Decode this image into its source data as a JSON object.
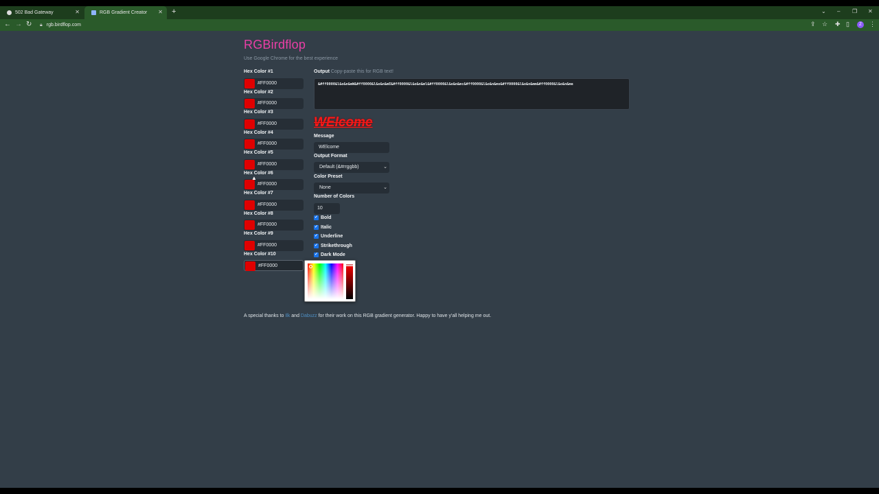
{
  "browser": {
    "tabs": [
      {
        "title": "502 Bad Gateway",
        "active": false
      },
      {
        "title": "RGB Gradient Creator",
        "active": true
      }
    ],
    "address": "rgb.birdflop.com"
  },
  "page": {
    "brand": "RGBirdflop",
    "subtitle": "Use Google Chrome for the best experience",
    "hex_colors": [
      {
        "label": "Hex Color #1",
        "value": "#FF0000"
      },
      {
        "label": "Hex Color #2",
        "value": "#FF0000"
      },
      {
        "label": "Hex Color #3",
        "value": "#FF0000"
      },
      {
        "label": "Hex Color #4",
        "value": "#FF0000"
      },
      {
        "label": "Hex Color #5",
        "value": "#FF0000"
      },
      {
        "label": "Hex Color #6",
        "value": "#FF0000"
      },
      {
        "label": "Hex Color #7",
        "value": "#FF0000"
      },
      {
        "label": "Hex Color #8",
        "value": "#FF0000"
      },
      {
        "label": "Hex Color #9",
        "value": "#FF0000"
      },
      {
        "label": "Hex Color #10",
        "value": "#FF0000"
      }
    ],
    "output": {
      "label": "Output",
      "hint": "Copy-paste this for RGB text!",
      "text": "&#ff0000&l&o&n&mW&#ff0000&l&o&n&mE&#ff0000&l&o&n&ml&#ff0000&l&o&n&mc&#ff0000&l&o&n&mo&#ff0000&l&o&n&mm&#ff0000&l&o&n&me"
    },
    "preview_text": "WElcome",
    "message": {
      "label": "Message",
      "value": "WElcome"
    },
    "output_format": {
      "label": "Output Format",
      "value": "Default (&#rrggbb)"
    },
    "color_preset": {
      "label": "Color Preset",
      "value": "None"
    },
    "number_of_colors": {
      "label": "Number of Colors",
      "value": "10"
    },
    "checkboxes": [
      {
        "label": "Bold",
        "checked": true
      },
      {
        "label": "Italic",
        "checked": true
      },
      {
        "label": "Underline",
        "checked": true
      },
      {
        "label": "Strikethrough",
        "checked": true
      },
      {
        "label": "Dark Mode",
        "checked": true
      }
    ],
    "thanks": {
      "prefix": "A special thanks to",
      "link1": "Ilk",
      "and": "and",
      "link2": "Dabuzz",
      "suffix": "for their work on this RGB gradient generator. Happy to have y'all helping me out."
    }
  },
  "colors": {
    "accent": "#ea3fa6",
    "swatch": "#e00000",
    "page_bg": "#333e48",
    "input_bg": "#262e36",
    "checkbox": "#1a73e8"
  },
  "icons": [
    "globe-icon",
    "close-icon",
    "plus-icon",
    "back-icon",
    "forward-icon",
    "reload-icon",
    "lock-icon",
    "share-icon",
    "star-icon",
    "extensions-icon",
    "sidebar-icon",
    "menu-icon",
    "chevron-down-icon",
    "checkmark-icon"
  ]
}
